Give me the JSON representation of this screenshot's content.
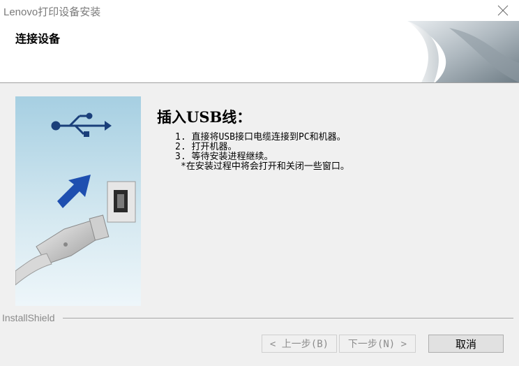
{
  "window": {
    "title": "Lenovo打印设备安装",
    "close_icon": "close-icon"
  },
  "header": {
    "title": "连接设备"
  },
  "main": {
    "heading": "插入USB线：",
    "steps": [
      "1. 直接将USB接口电缆连接到PC和机器。",
      "2. 打开机器。",
      "3. 等待安装进程继续。"
    ],
    "note": "*在安装过程中将会打开和关闭一些窗口。"
  },
  "footer": {
    "brand": "InstallShield",
    "back_label": "< 上一步(B)",
    "next_label": "下一步(N) >",
    "cancel_label": "取消"
  }
}
